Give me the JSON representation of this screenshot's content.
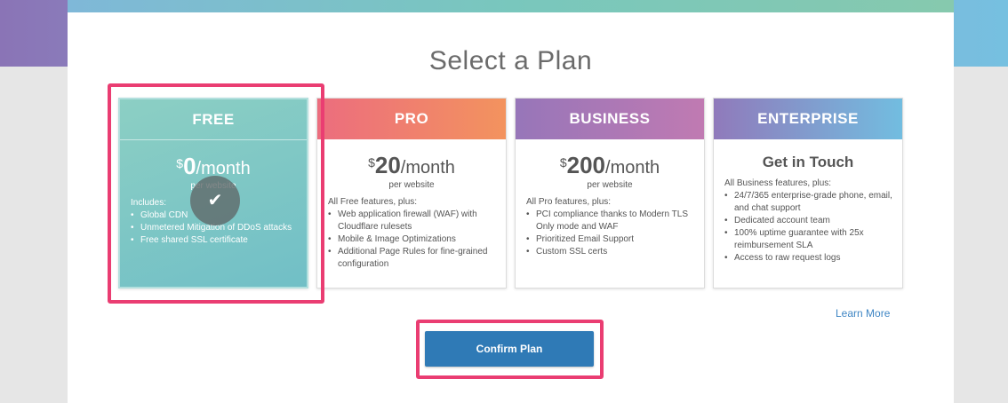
{
  "page": {
    "title": "Select a Plan"
  },
  "plans": {
    "free": {
      "name": "FREE",
      "currency": "$",
      "amount": "0",
      "period": "/month",
      "subtext": "per website",
      "intro": "Includes:",
      "features": [
        "Global CDN",
        "Unmetered Mitigation of DDoS attacks",
        "Free shared SSL certificate"
      ],
      "selected_icon": "check-icon"
    },
    "pro": {
      "name": "PRO",
      "currency": "$",
      "amount": "20",
      "period": "/month",
      "subtext": "per website",
      "intro": "All Free features, plus:",
      "features": [
        "Web application firewall (WAF) with Cloudflare rulesets",
        "Mobile & Image Optimizations",
        "Additional Page Rules for fine-grained configuration"
      ]
    },
    "business": {
      "name": "BUSINESS",
      "currency": "$",
      "amount": "200",
      "period": "/month",
      "subtext": "per website",
      "intro": "All Pro features, plus:",
      "features": [
        "PCI compliance thanks to Modern TLS Only mode and WAF",
        "Prioritized Email Support",
        "Custom SSL certs"
      ]
    },
    "enterprise": {
      "name": "ENTERPRISE",
      "contact": "Get in Touch",
      "intro": "All Business features, plus:",
      "features": [
        "24/7/365 enterprise-grade phone, email, and chat support",
        "Dedicated account team",
        "100% uptime guarantee with 25x reimbursement SLA",
        "Access to raw request logs"
      ]
    }
  },
  "actions": {
    "learn_more": "Learn More",
    "confirm": "Confirm Plan"
  },
  "colors": {
    "highlight": "#ea3d72",
    "confirm_button": "#2f7ab6",
    "free_card": "#7cc6c4",
    "pro_header": "#ef7d6c",
    "business_header": "#a677b6",
    "enterprise_header": "#82a0cf",
    "link": "#3f86c4"
  }
}
